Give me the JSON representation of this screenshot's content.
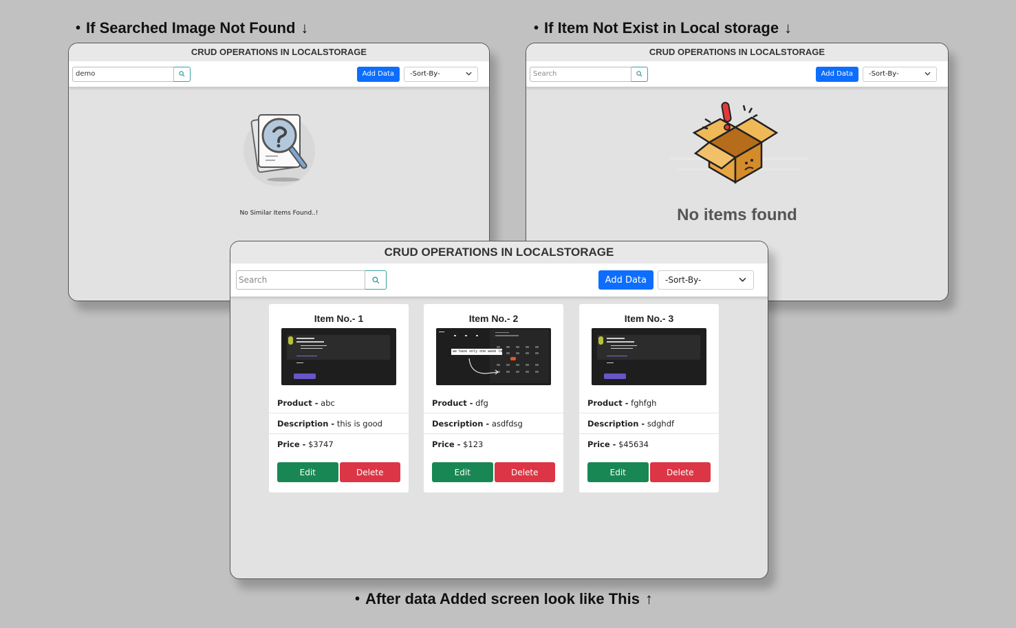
{
  "captions": {
    "not_found": "If Searched Image Not Found",
    "not_exist": "If Item Not Exist in Local storage",
    "added": "After data Added screen look like This",
    "bullet": "•",
    "arrow_down": "↓",
    "arrow_up": "↑"
  },
  "windows": {
    "search_empty": {
      "title": "CRUD OPERATIONS IN LOCALSTORAGE",
      "search_value": "demo",
      "add_label": "Add Data",
      "sort_label": "-Sort-By-",
      "message": "No Similar Items Found..!"
    },
    "storage_empty": {
      "title": "CRUD OPERATIONS IN LOCALSTORAGE",
      "search_placeholder": "Search",
      "add_label": "Add Data",
      "sort_label": "-Sort-By-",
      "message": "No items found"
    },
    "main": {
      "title": "CRUD OPERATIONS IN LOCALSTORAGE",
      "search_placeholder": "Search",
      "add_label": "Add Data",
      "sort_label": "-Sort-By-",
      "edit_label": "Edit",
      "delete_label": "Delete",
      "product_label": "Product -",
      "description_label": "Description -",
      "price_label": "Price -",
      "items": [
        {
          "title": "Item No.- 1",
          "product": "abc",
          "description": "this is good",
          "price": "$3747"
        },
        {
          "title": "Item No.- 2",
          "product": "dfg",
          "description": "asdfdsg",
          "price": "$123",
          "banner": "we have only one week left"
        },
        {
          "title": "Item No.- 3",
          "product": "fghfgh",
          "description": "sdghdf",
          "price": "$45634"
        }
      ]
    }
  },
  "icons": {
    "search": "search-icon",
    "chevron": "chevron-down-icon",
    "not_found_illustration": "document-magnifier-question-icon",
    "empty_box_illustration": "open-box-exclamation-icon"
  },
  "colors": {
    "primary": "#0d6efd",
    "edit": "#198754",
    "delete": "#dc3545",
    "background": "#c1c1c1"
  }
}
